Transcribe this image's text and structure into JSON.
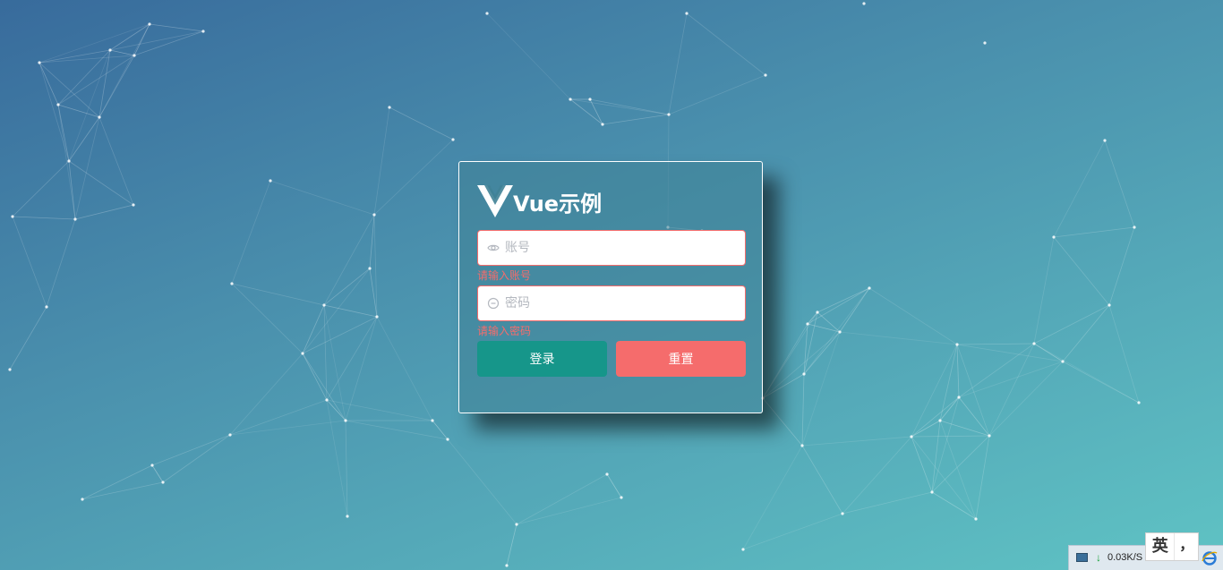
{
  "login": {
    "title": "Vue示例",
    "username": {
      "placeholder": "账号",
      "value": "",
      "error": "请输入账号"
    },
    "password": {
      "placeholder": "密码",
      "value": "",
      "error": "请输入密码"
    },
    "login_label": "登录",
    "reset_label": "重置"
  },
  "taskbar": {
    "net_speed": "0.03K/S"
  },
  "ime": {
    "language": "英",
    "punctuation": "，"
  },
  "colors": {
    "login_button": "#16968a",
    "reset_button": "#f56c6c",
    "error": "#f56c6c",
    "background_start": "#386b9c",
    "background_end": "#5fc3c4"
  },
  "icons": {
    "logo": "vue-logo-icon",
    "username": "eye-icon",
    "password": "minus-circle-icon",
    "net_arrow": "download-arrow-icon",
    "browser": "ie-icon"
  }
}
